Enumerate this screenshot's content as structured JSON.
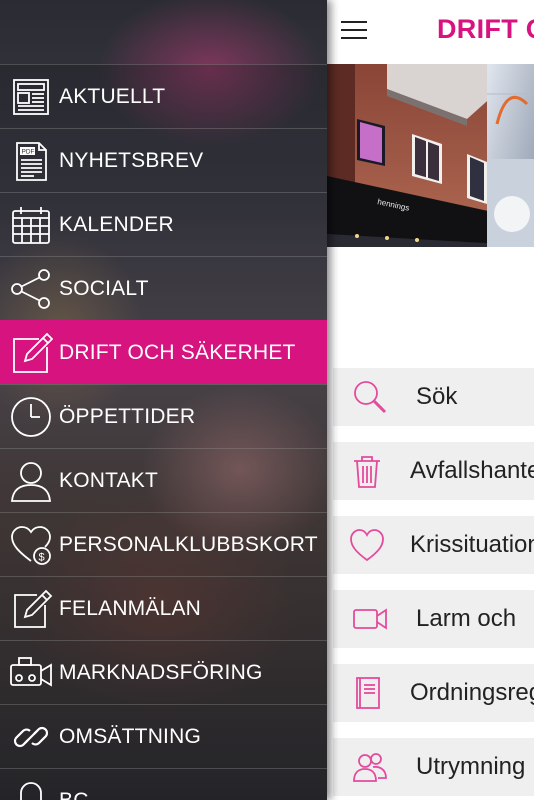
{
  "drawer": {
    "accent": "#d6137f",
    "items": [
      {
        "label": "AKTUELLT",
        "icon": "newspaper-icon"
      },
      {
        "label": "NYHETSBREV",
        "icon": "pdf-document-icon",
        "icon_text": "PDF"
      },
      {
        "label": "KALENDER",
        "icon": "calendar-icon"
      },
      {
        "label": "SOCIALT",
        "icon": "share-icon"
      },
      {
        "label": "DRIFT OCH SÄKERHET",
        "icon": "edit-icon",
        "active": true
      },
      {
        "label": "ÖPPETTIDER",
        "icon": "clock-icon"
      },
      {
        "label": "KONTAKT",
        "icon": "person-icon"
      },
      {
        "label": "PERSONALKLUBBSKORT",
        "icon": "heart-money-icon"
      },
      {
        "label": "FELANMÄLAN",
        "icon": "edit-icon"
      },
      {
        "label": "MARKNADSFÖRING",
        "icon": "video-camera-icon"
      },
      {
        "label": "OMSÄTTNING",
        "icon": "link-icon"
      },
      {
        "label": "BC",
        "icon": "lock-icon"
      }
    ]
  },
  "header": {
    "title": "DRIFT OCH SÄKERHET",
    "menu_icon": "hamburger-menu-icon"
  },
  "main": {
    "list": [
      {
        "label": "Sök",
        "icon": "search-icon"
      },
      {
        "label": "Avfallshantering",
        "icon": "trash-icon"
      },
      {
        "label": "Krissituationer",
        "icon": "heart-icon"
      },
      {
        "label": "Larm och",
        "icon": "video-camera-icon"
      },
      {
        "label": "Ordningsregler",
        "icon": "book-icon"
      },
      {
        "label": "Utrymning",
        "icon": "people-icon"
      }
    ]
  }
}
